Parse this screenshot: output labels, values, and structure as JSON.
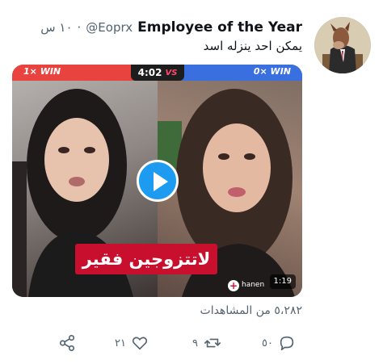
{
  "tweet": {
    "display_name": "Employee of the Year",
    "handle": "@Eoprx",
    "separator": "·",
    "time": "١٠ س",
    "text": "يمكن احد ينزله اسد"
  },
  "media": {
    "score_left": "1× WIN",
    "score_right": "0× WIN",
    "timer": "4:02",
    "vs": "VS",
    "caption": "لاتتزوجين فقير",
    "watermark_user": "hanen",
    "duration": "1:19"
  },
  "stats": {
    "views": "٥،٢٨٢ من المشاهدات"
  },
  "actions": {
    "reply_count": "٥٠",
    "retweet_count": "٩",
    "like_count": "٢١"
  },
  "colors": {
    "accent": "#1d9bf0",
    "text_secondary": "#536471",
    "text_primary": "#0f1419",
    "win_left": "#e9433f",
    "win_right": "#3a6fe0",
    "caption_bg": "#c8102e"
  },
  "icons": [
    "reply-icon",
    "retweet-icon",
    "like-icon",
    "share-icon",
    "play-icon"
  ]
}
